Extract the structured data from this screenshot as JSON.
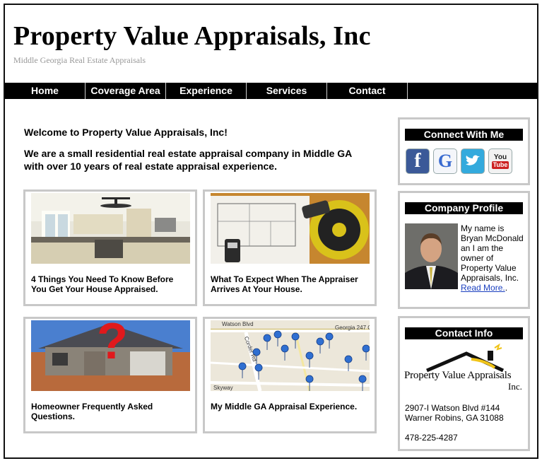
{
  "site": {
    "title": "Property Value Appraisals, Inc",
    "tagline": "Middle Georgia Real Estate Appraisals"
  },
  "nav": {
    "items": [
      "Home",
      "Coverage Area",
      "Experience",
      "Services",
      "Contact"
    ]
  },
  "welcome": {
    "heading": "Welcome to Property Value Appraisals, Inc!",
    "body": "We are a small residential real estate appraisal company in Middle GA with over 10 years of real estate appraisal experience."
  },
  "cards": [
    {
      "caption": "4 Things You Need To Know Before You Get Your House Appraised.",
      "image": "kitchen-photo"
    },
    {
      "caption": "What To Expect When The Appraiser Arrives At Your House.",
      "image": "tape-measure-blueprint-photo"
    },
    {
      "caption": "Homeowner Frequently Asked Questions.",
      "image": "house-question-photo"
    },
    {
      "caption": "My Middle GA Appraisal Experience.",
      "image": "map-pins-photo"
    }
  ],
  "map_labels": {
    "road1": "Watson Blvd",
    "road2": "Georgia 247 C",
    "road3": "Corder Rd",
    "road4": "Skyway"
  },
  "question_mark": "?",
  "connect": {
    "heading": "Connect With Me",
    "icons": [
      "facebook-icon",
      "google-icon",
      "twitter-icon",
      "youtube-icon"
    ],
    "glyphs": {
      "facebook": "f",
      "google": "G",
      "youtube_top": "You",
      "youtube_bottom": "Tube"
    }
  },
  "profile": {
    "heading": "Company Profile",
    "bio": "My name is Bryan McDonald an I am the owner of Property Value Appraisals, Inc.",
    "link": "Read More.",
    "trailing": "."
  },
  "contact": {
    "heading": "Contact Info",
    "logo_line1": "Property Value Appraisals",
    "logo_line2": "Inc.",
    "address_line1": "2907-I Watson Blvd #144",
    "address_line2": "Warner Robins, GA 31088",
    "phone": "478-225-4287"
  },
  "colors": {
    "nav_bg": "#000000",
    "card_border": "#c8c8c8",
    "link": "#1a3fbf",
    "facebook": "#3b5998",
    "twitter": "#33aadd",
    "youtube": "#cc2222",
    "logo_gold": "#f0c419"
  }
}
